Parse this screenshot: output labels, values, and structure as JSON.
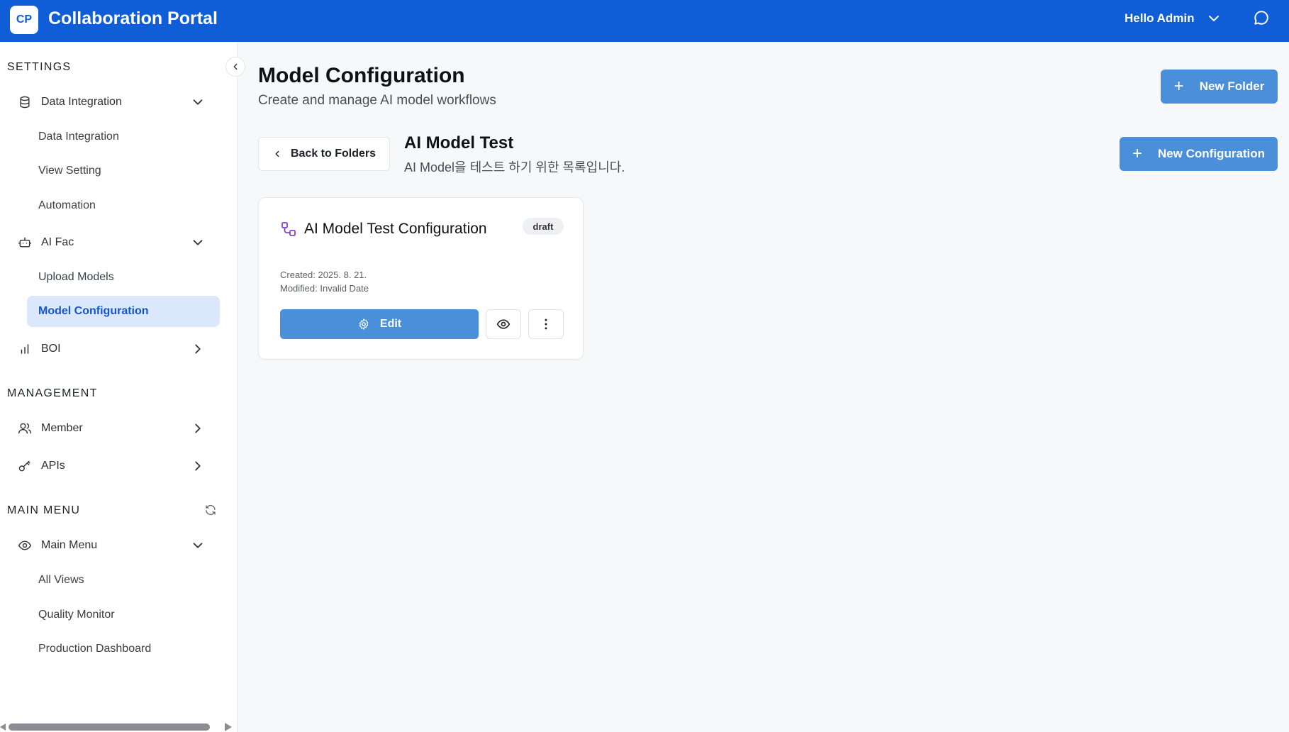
{
  "header": {
    "logo": "CP",
    "title": "Collaboration Portal",
    "user_greeting": "Hello Admin",
    "brand_color": "#0f5ed8"
  },
  "sidebar": {
    "sections": {
      "settings": "SETTINGS",
      "management": "MANAGEMENT",
      "main_menu": "MAIN MENU"
    },
    "groups": {
      "data_integration": "Data Integration",
      "ai_fac": "AI Fac",
      "boi": "BOI",
      "member": "Member",
      "apis": "APIs",
      "main_menu": "Main Menu"
    },
    "subitems": {
      "data_integration": "Data Integration",
      "view_setting": "View Setting",
      "automation": "Automation",
      "upload_models": "Upload Models",
      "model_configuration": "Model Configuration",
      "all_views": "All Views",
      "quality_monitor": "Quality Monitor",
      "production_dashboard": "Production Dashboard"
    },
    "active_item": "Model Configuration",
    "active_color": "#dbe8fb"
  },
  "main": {
    "title": "Model Configuration",
    "subtitle": "Create and manage AI model workflows",
    "new_folder_label": "New Folder",
    "back_label": "Back to Folders",
    "folder_title": "AI Model Test",
    "folder_description": "AI Model을 테스트 하기 위한 목록입니다.",
    "new_configuration_label": "New Configuration",
    "accent_color": "#4a8fd9"
  },
  "card": {
    "title": "AI Model Test Configuration",
    "status": "draft",
    "created": "Created: 2025. 8. 21.",
    "modified": "Modified: Invalid Date",
    "edit_label": "Edit"
  }
}
